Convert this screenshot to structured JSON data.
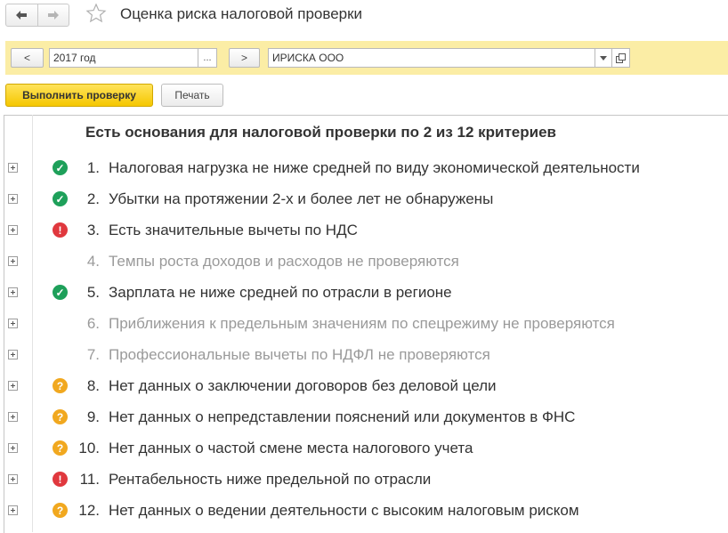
{
  "window": {
    "title": "Оценка риска налоговой проверки"
  },
  "filters": {
    "prev_label": "<",
    "period_value": "2017 год",
    "period_select_label": "...",
    "next_label": ">",
    "organization_value": "ИРИСКА ООО"
  },
  "commands": {
    "run_check_label": "Выполнить проверку",
    "print_label": "Печать"
  },
  "report": {
    "header": "Есть основания для налоговой проверки по 2 из 12 критериев",
    "criteria": [
      {
        "num": "1.",
        "text": "Налоговая нагрузка не ниже средней по виду экономической деятельности",
        "status": "ok"
      },
      {
        "num": "2.",
        "text": "Убытки на протяжении 2-х и более лет не обнаружены",
        "status": "ok"
      },
      {
        "num": "3.",
        "text": "Есть значительные вычеты по НДС",
        "status": "risk"
      },
      {
        "num": "4.",
        "text": "Темпы роста доходов и расходов не проверяются",
        "status": "not-checked"
      },
      {
        "num": "5.",
        "text": "Зарплата не ниже средней по отрасли в регионе",
        "status": "ok"
      },
      {
        "num": "6.",
        "text": "Приближения к предельным значениям по спецрежиму не проверяются",
        "status": "not-checked"
      },
      {
        "num": "7.",
        "text": "Профессиональные вычеты по НДФЛ не проверяются",
        "status": "not-checked"
      },
      {
        "num": "8.",
        "text": "Нет данных о заключении договоров без деловой цели",
        "status": "unknown"
      },
      {
        "num": "9.",
        "text": "Нет данных о непредставлении пояснений или документов в ФНС",
        "status": "unknown"
      },
      {
        "num": "10.",
        "text": "Нет данных о частой смене места налогового учета",
        "status": "unknown"
      },
      {
        "num": "11.",
        "text": "Рентабельность ниже предельной по отрасли",
        "status": "risk"
      },
      {
        "num": "12.",
        "text": "Нет данных о ведении деятельности с высоким налоговым риском",
        "status": "unknown"
      }
    ]
  },
  "colors": {
    "filter_panel": "#fbeda5",
    "primary_button": "#f5c700",
    "status_ok": "#1ea05a",
    "status_risk": "#e0383e",
    "status_unknown": "#f1a81f",
    "muted_text": "#9a9a9a"
  },
  "icons": {
    "back": "arrow-left-icon",
    "forward": "arrow-right-icon",
    "favorite": "star-outline-icon",
    "dropdown": "triangle-down-icon",
    "open": "open-window-icon",
    "expand": "plus-square-icon",
    "ok": "checkmark-circle-icon",
    "risk": "exclamation-circle-icon",
    "unknown": "question-circle-icon"
  }
}
